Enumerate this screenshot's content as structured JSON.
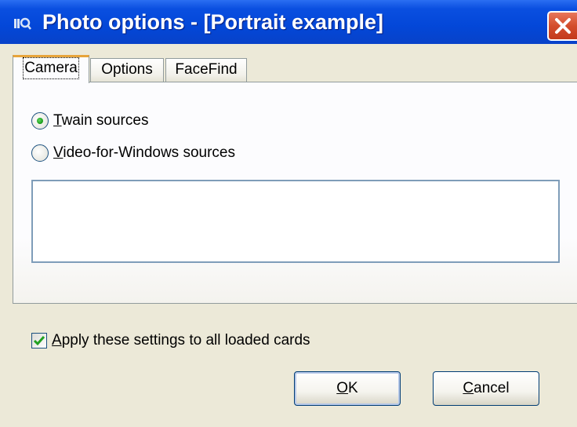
{
  "window": {
    "title": "Photo options - [Portrait example]",
    "icon": "app-icon",
    "close_icon": "close-icon"
  },
  "tabs": [
    {
      "label": "Camera",
      "active": true
    },
    {
      "label": "Options",
      "active": false
    },
    {
      "label": "FaceFind",
      "active": false
    }
  ],
  "camera": {
    "radio_twain": {
      "mnemonic": "T",
      "rest": "wain sources",
      "checked": true
    },
    "radio_vfw": {
      "mnemonic": "V",
      "rest": "ideo-for-Windows sources",
      "checked": false
    },
    "sources_list": []
  },
  "apply_all": {
    "mnemonic": "A",
    "rest": "pply these settings to all loaded cards",
    "checked": true
  },
  "buttons": {
    "ok": {
      "mnemonic": "O",
      "rest": "K"
    },
    "cancel": {
      "mnemonic": "C",
      "rest": "ancel"
    }
  },
  "colors": {
    "titlebar": "#0347d8",
    "dialog_bg": "#ece9d8",
    "close": "#d34d2c",
    "check_green": "#21a121"
  }
}
